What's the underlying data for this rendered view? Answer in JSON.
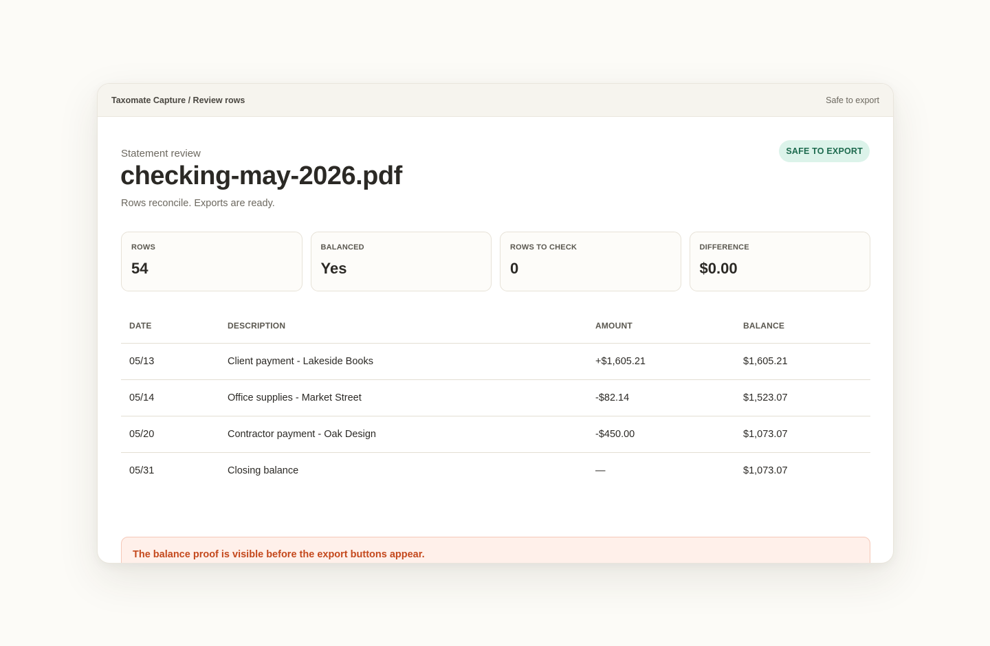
{
  "titlebar": {
    "breadcrumb": "Taxomate Capture / Review rows",
    "status": "Safe to export"
  },
  "header": {
    "eyebrow": "Statement review",
    "title": "checking-may-2026.pdf",
    "subtitle": "Rows reconcile. Exports are ready.",
    "badge": "SAFE TO EXPORT"
  },
  "stats": [
    {
      "label": "ROWS",
      "value": "54"
    },
    {
      "label": "BALANCED",
      "value": "Yes"
    },
    {
      "label": "ROWS TO CHECK",
      "value": "0"
    },
    {
      "label": "DIFFERENCE",
      "value": "$0.00"
    }
  ],
  "table": {
    "headers": {
      "date": "DATE",
      "description": "DESCRIPTION",
      "amount": "AMOUNT",
      "balance": "BALANCE"
    },
    "rows": [
      {
        "date": "05/13",
        "description": "Client payment - Lakeside Books",
        "amount": "+$1,605.21",
        "balance": "$1,605.21"
      },
      {
        "date": "05/14",
        "description": "Office supplies - Market Street",
        "amount": "-$82.14",
        "balance": "$1,523.07"
      },
      {
        "date": "05/20",
        "description": "Contractor payment - Oak Design",
        "amount": "-$450.00",
        "balance": "$1,073.07"
      },
      {
        "date": "05/31",
        "description": "Closing balance",
        "amount": "—",
        "balance": "$1,073.07"
      }
    ]
  },
  "notice": "The balance proof is visible before the export buttons appear.",
  "colors": {
    "badge_bg": "#dcf3ea",
    "badge_text": "#1d6a4e",
    "notice_bg": "#fff0ea",
    "notice_text": "#c4491d"
  }
}
